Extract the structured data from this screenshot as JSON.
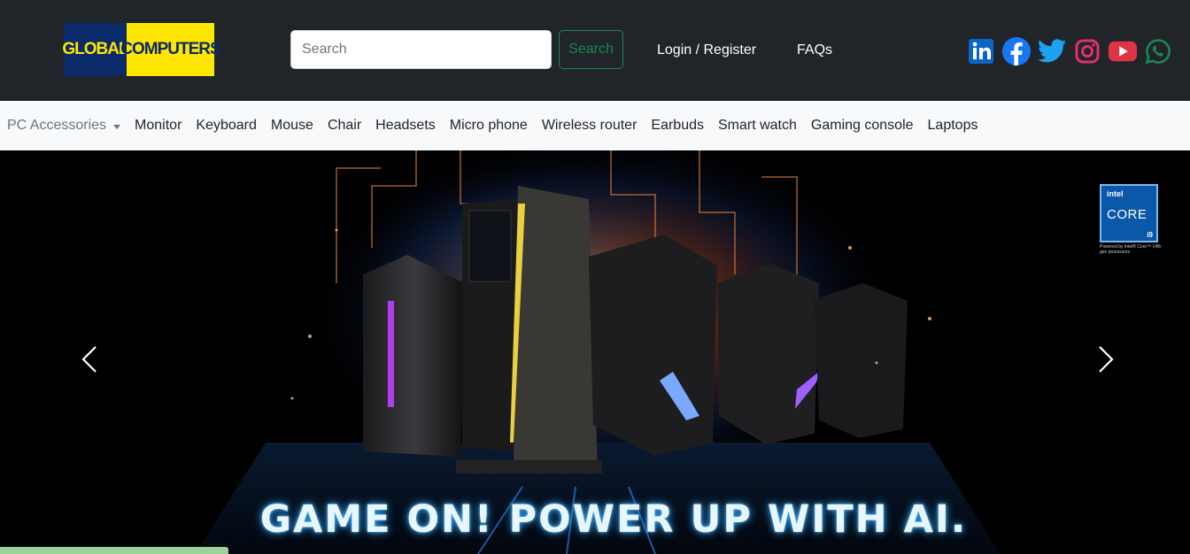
{
  "header": {
    "logo": {
      "part1": "GLOBAL",
      "part2": "COMPUTERS"
    },
    "search": {
      "placeholder": "Search",
      "button_label": "Search"
    },
    "login_label": "Login / Register",
    "faqs_label": "FAQs",
    "social": [
      {
        "icon": "linkedin-icon",
        "color": "#0a66c2"
      },
      {
        "icon": "facebook-icon",
        "color": "#1877f2"
      },
      {
        "icon": "twitter-icon",
        "color": "#1da1f2"
      },
      {
        "icon": "instagram-icon",
        "color": "#e1306c"
      },
      {
        "icon": "youtube-icon",
        "color": "#dc3545"
      },
      {
        "icon": "whatsapp-icon",
        "color": "#198754"
      }
    ]
  },
  "nav": {
    "dropdown_label": "PC Accessories",
    "items": [
      "Monitor",
      "Keyboard",
      "Mouse",
      "Chair",
      "Headsets",
      "Micro phone",
      "Wireless router",
      "Earbuds",
      "Smart watch",
      "Gaming console",
      "Laptops"
    ]
  },
  "carousel": {
    "headline": "GAME ON! POWER UP WITH AI.",
    "badge": {
      "brand": "intel",
      "line": "CORE",
      "gen": "i9",
      "caption": "Powered by Intel® Core™ 14th gen processors"
    }
  },
  "colors": {
    "header_bg": "#212529",
    "nav_bg": "#f8f9fa",
    "accent_green": "#198754"
  }
}
